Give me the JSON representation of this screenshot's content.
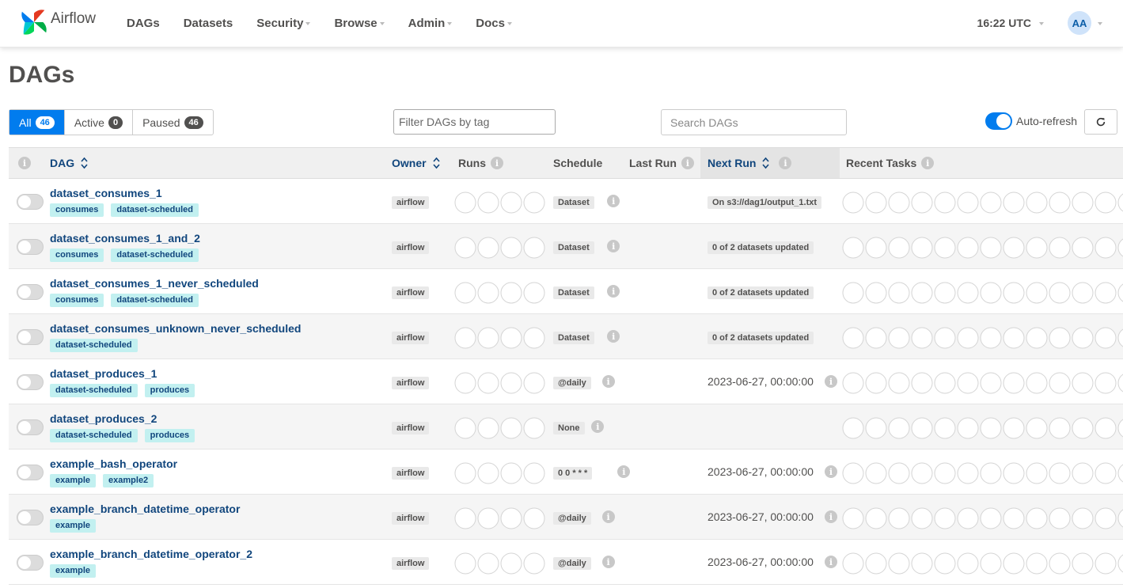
{
  "nav": {
    "brand": "Airflow",
    "items": [
      {
        "label": "DAGs",
        "dropdown": false
      },
      {
        "label": "Datasets",
        "dropdown": false
      },
      {
        "label": "Security",
        "dropdown": true
      },
      {
        "label": "Browse",
        "dropdown": true
      },
      {
        "label": "Admin",
        "dropdown": true
      },
      {
        "label": "Docs",
        "dropdown": true
      }
    ],
    "clock": "16:22 UTC",
    "avatar": "AA"
  },
  "page_title": "DAGs",
  "status_filters": [
    {
      "label": "All",
      "count": "46",
      "active": true
    },
    {
      "label": "Active",
      "count": "0",
      "active": false
    },
    {
      "label": "Paused",
      "count": "46",
      "active": false
    }
  ],
  "tag_filter": {
    "placeholder": "Filter DAGs by tag"
  },
  "search": {
    "placeholder": "Search DAGs"
  },
  "auto_refresh": {
    "label": "Auto-refresh",
    "enabled": true
  },
  "columns": {
    "dag": "DAG",
    "owner": "Owner",
    "runs": "Runs",
    "schedule": "Schedule",
    "last_run": "Last Run",
    "next_run": "Next Run",
    "recent_tasks": "Recent Tasks"
  },
  "info_glyph": "i",
  "colors": {
    "accent": "#017cee",
    "link": "#11467d",
    "tag_bg": "#c2f0f0"
  },
  "rows": [
    {
      "name": "dataset_consumes_1",
      "tags": [
        "consumes",
        "dataset-scheduled"
      ],
      "owner": "airflow",
      "schedule": "Dataset",
      "next_run": "On s3://dag1/output_1.txt",
      "next_run_style": "badge"
    },
    {
      "name": "dataset_consumes_1_and_2",
      "tags": [
        "consumes",
        "dataset-scheduled"
      ],
      "owner": "airflow",
      "schedule": "Dataset",
      "next_run": "0 of 2 datasets updated",
      "next_run_style": "badge"
    },
    {
      "name": "dataset_consumes_1_never_scheduled",
      "tags": [
        "consumes",
        "dataset-scheduled"
      ],
      "owner": "airflow",
      "schedule": "Dataset",
      "next_run": "0 of 2 datasets updated",
      "next_run_style": "badge"
    },
    {
      "name": "dataset_consumes_unknown_never_scheduled",
      "tags": [
        "dataset-scheduled"
      ],
      "owner": "airflow",
      "schedule": "Dataset",
      "next_run": "0 of 2 datasets updated",
      "next_run_style": "badge"
    },
    {
      "name": "dataset_produces_1",
      "tags": [
        "dataset-scheduled",
        "produces"
      ],
      "owner": "airflow",
      "schedule": "@daily",
      "next_run": "2023-06-27, 00:00:00",
      "next_run_style": "text"
    },
    {
      "name": "dataset_produces_2",
      "tags": [
        "dataset-scheduled",
        "produces"
      ],
      "owner": "airflow",
      "schedule": "None",
      "next_run": "",
      "next_run_style": "none"
    },
    {
      "name": "example_bash_operator",
      "tags": [
        "example",
        "example2"
      ],
      "owner": "airflow",
      "schedule": "0 0 * * *",
      "next_run": "2023-06-27, 00:00:00",
      "next_run_style": "text"
    },
    {
      "name": "example_branch_datetime_operator",
      "tags": [
        "example"
      ],
      "owner": "airflow",
      "schedule": "@daily",
      "next_run": "2023-06-27, 00:00:00",
      "next_run_style": "text"
    },
    {
      "name": "example_branch_datetime_operator_2",
      "tags": [
        "example"
      ],
      "owner": "airflow",
      "schedule": "@daily",
      "next_run": "2023-06-27, 00:00:00",
      "next_run_style": "text"
    }
  ]
}
